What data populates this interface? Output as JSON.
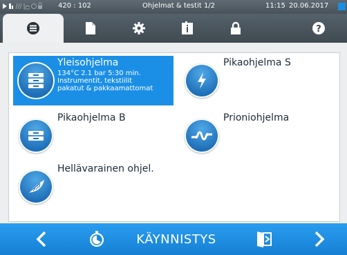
{
  "status_bar": {
    "coords": "420 : 102",
    "title": "Ohjelmat & testit 1/2",
    "time": "11:15",
    "date": "20.06.2017"
  },
  "tabs": [
    {
      "icon": "list-icon",
      "active": true
    },
    {
      "icon": "document-icon",
      "active": false
    },
    {
      "icon": "gear-icon",
      "active": false
    },
    {
      "icon": "info-book-icon",
      "active": false
    },
    {
      "icon": "lock-icon",
      "active": false
    },
    {
      "icon": "help-icon",
      "active": false
    }
  ],
  "programs": {
    "yleis": {
      "title": "Yleisohjelma",
      "desc1": "134°C 2.1 bar 5:30 min.",
      "desc2": "Instrumentit, tekstiilit",
      "desc3": "pakatut & pakkaamattomat",
      "selected": true
    },
    "pika_s": {
      "title": "Pikaohjelma S"
    },
    "pika_b": {
      "title": "Pikaohjelma B"
    },
    "prioni": {
      "title": "Prioniohjelma"
    },
    "hella": {
      "title": "Hellävarainen ohjel."
    }
  },
  "bottom_bar": {
    "start_label": "KÄYNNISTYS"
  },
  "colors": {
    "accent": "#1b8fe6",
    "bar_dark": "#47525a",
    "icon_blue": "#1f6fb8"
  }
}
